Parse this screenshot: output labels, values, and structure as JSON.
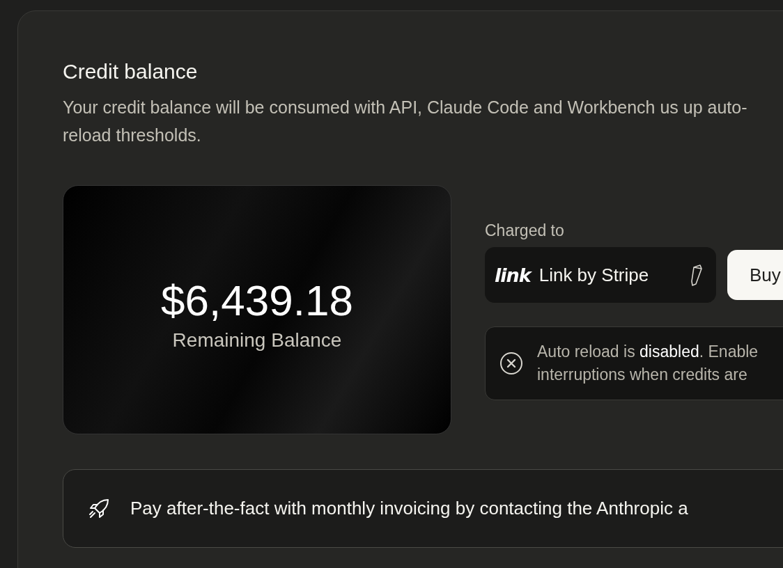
{
  "section": {
    "title": "Credit balance",
    "description": "Your credit balance will be consumed with API, Claude Code and Workbench us up auto-reload thresholds."
  },
  "balance": {
    "amount": "$6,439.18",
    "label": "Remaining Balance"
  },
  "payment": {
    "label": "Charged to",
    "logo": "link",
    "method": "Link by Stripe",
    "buy_button": "Buy"
  },
  "auto_reload": {
    "enabled": false,
    "lines": [
      "Auto reload is **disabled**. Enable",
      "interruptions when credits are"
    ]
  },
  "invoice_banner": {
    "text": "Pay after-the-fact with monthly invoicing by contacting the Anthropic a"
  }
}
